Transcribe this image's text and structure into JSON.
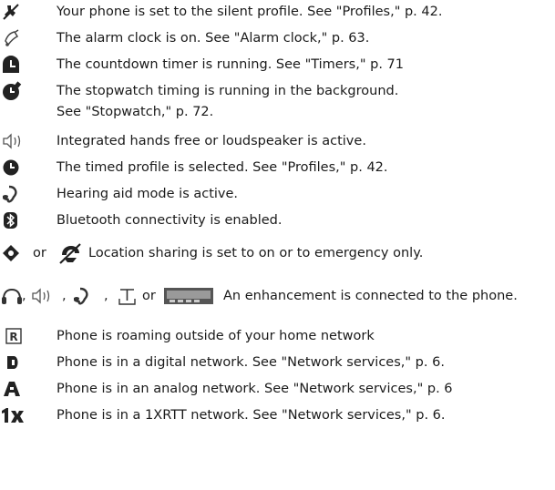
{
  "items": [
    {
      "icon": "silent-profile-icon",
      "text": "Your phone is set to the silent profile. See \"Profiles,\" p. 42."
    },
    {
      "icon": "alarm-clock-icon",
      "text": "The alarm clock is on. See \"Alarm clock,\" p. 63."
    },
    {
      "icon": "countdown-timer-icon",
      "text": "The countdown timer is running. See \"Timers,\" p. 71"
    },
    {
      "icon": "stopwatch-icon",
      "text": "The stopwatch timing is running in the background.",
      "text2": "See \"Stopwatch,\" p. 72."
    },
    {
      "icon": "loudspeaker-icon",
      "text": "Integrated hands free or loudspeaker is active."
    },
    {
      "icon": "timed-profile-icon",
      "text": "The timed profile is selected. See \"Profiles,\" p. 42."
    },
    {
      "icon": "hearing-aid-icon",
      "text": "Hearing aid mode is active."
    },
    {
      "icon": "bluetooth-icon",
      "text": "Bluetooth connectivity is enabled."
    }
  ],
  "location": {
    "or_label": "or",
    "text": "Location sharing is set to on or to emergency only."
  },
  "enhancement": {
    "sep1": ",",
    "sep2": ",",
    "sep3": ",",
    "or_label": "or",
    "text": "An enhancement is connected to the phone."
  },
  "network": [
    {
      "icon": "roaming-icon",
      "text": "Phone is roaming outside of your home network"
    },
    {
      "icon": "digital-network-icon",
      "text": "Phone is in a digital network. See \"Network services,\" p. 6."
    },
    {
      "icon": "analog-network-icon",
      "text": "Phone is in an analog network. See \"Network services,\" p. 6"
    },
    {
      "icon": "1xrtt-network-icon",
      "text": "Phone is in a 1XRTT network. See \"Network services,\" p. 6."
    }
  ]
}
